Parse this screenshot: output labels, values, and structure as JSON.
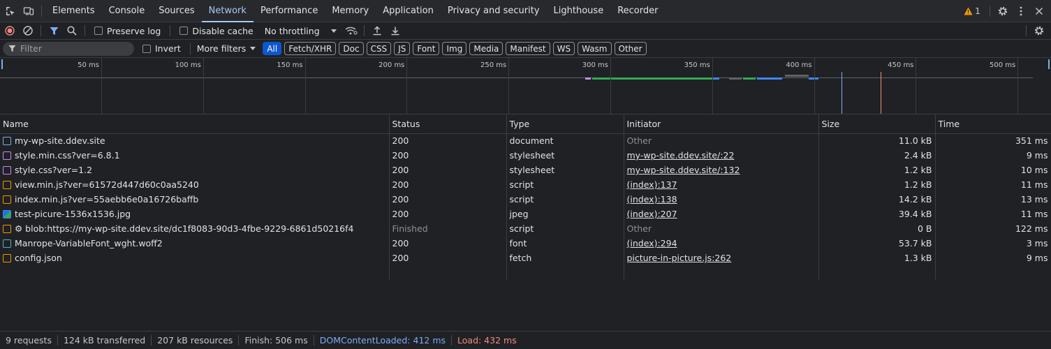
{
  "tabs": [
    "Elements",
    "Console",
    "Sources",
    "Network",
    "Performance",
    "Memory",
    "Application",
    "Privacy and security",
    "Lighthouse",
    "Recorder"
  ],
  "active_tab": "Network",
  "warnings_count": "1",
  "toolbar": {
    "preserve_log": "Preserve log",
    "disable_cache": "Disable cache",
    "throttling": "No throttling"
  },
  "filterbar": {
    "placeholder": "Filter",
    "invert": "Invert",
    "more_filters": "More filters",
    "chips": [
      "All",
      "Fetch/XHR",
      "Doc",
      "CSS",
      "JS",
      "Font",
      "Img",
      "Media",
      "Manifest",
      "WS",
      "Wasm",
      "Other"
    ],
    "active_chip": "All"
  },
  "overview": {
    "ticks": [
      "50 ms",
      "100 ms",
      "150 ms",
      "200 ms",
      "250 ms",
      "300 ms",
      "350 ms",
      "400 ms",
      "450 ms",
      "500 ms"
    ]
  },
  "table": {
    "columns": [
      "Name",
      "Status",
      "Type",
      "Initiator",
      "Size",
      "Time"
    ],
    "rows": [
      {
        "icon": "document",
        "name": "my-wp-site.ddev.site",
        "status": "200",
        "type": "document",
        "initiator": "Other",
        "initiator_link": false,
        "size": "11.0 kB",
        "time": "351 ms"
      },
      {
        "icon": "stylesheet",
        "name": "style.min.css?ver=6.8.1",
        "status": "200",
        "type": "stylesheet",
        "initiator": "my-wp-site.ddev.site/:22",
        "initiator_link": true,
        "size": "2.4 kB",
        "time": "9 ms"
      },
      {
        "icon": "stylesheet",
        "name": "style.css?ver=1.2",
        "status": "200",
        "type": "stylesheet",
        "initiator": "my-wp-site.ddev.site/:132",
        "initiator_link": true,
        "size": "1.2 kB",
        "time": "10 ms"
      },
      {
        "icon": "script",
        "name": "view.min.js?ver=61572d447d60c0aa5240",
        "status": "200",
        "type": "script",
        "initiator": "(index):137",
        "initiator_link": true,
        "size": "1.2 kB",
        "time": "11 ms"
      },
      {
        "icon": "script",
        "name": "index.min.js?ver=55aebb6e0a16726baffb",
        "status": "200",
        "type": "script",
        "initiator": "(index):138",
        "initiator_link": true,
        "size": "14.2 kB",
        "time": "13 ms"
      },
      {
        "icon": "image",
        "name": "test-picure-1536x1536.jpg",
        "status": "200",
        "type": "jpeg",
        "initiator": "(index):207",
        "initiator_link": true,
        "size": "39.4 kB",
        "time": "11 ms"
      },
      {
        "icon": "script",
        "name": "⚙ blob:https://my-wp-site.ddev.site/dc1f8083-90d3-4fbe-9229-6861d50216f4",
        "status": "Finished",
        "type": "script",
        "initiator": "Other",
        "initiator_link": false,
        "size": "0 B",
        "time": "122 ms"
      },
      {
        "icon": "font",
        "name": "Manrope-VariableFont_wght.woff2",
        "status": "200",
        "type": "font",
        "initiator": "(index):294",
        "initiator_link": true,
        "size": "53.7 kB",
        "time": "3 ms"
      },
      {
        "icon": "fetch",
        "name": "config.json",
        "status": "200",
        "type": "fetch",
        "initiator": "picture-in-picture.js:262",
        "initiator_link": true,
        "size": "1.3 kB",
        "time": "9 ms"
      }
    ]
  },
  "status": {
    "requests": "9 requests",
    "transferred": "124 kB transferred",
    "resources": "207 kB resources",
    "finish": "Finish: 506 ms",
    "dcl": "DOMContentLoaded: 412 ms",
    "load": "Load: 432 ms"
  },
  "colors": {
    "accent": "#a8c7fa",
    "chip_active": "#0b57d0",
    "record": "#f28b82",
    "dcl": "#7cacf8",
    "load": "#f28b82",
    "warning": "#f29900"
  }
}
